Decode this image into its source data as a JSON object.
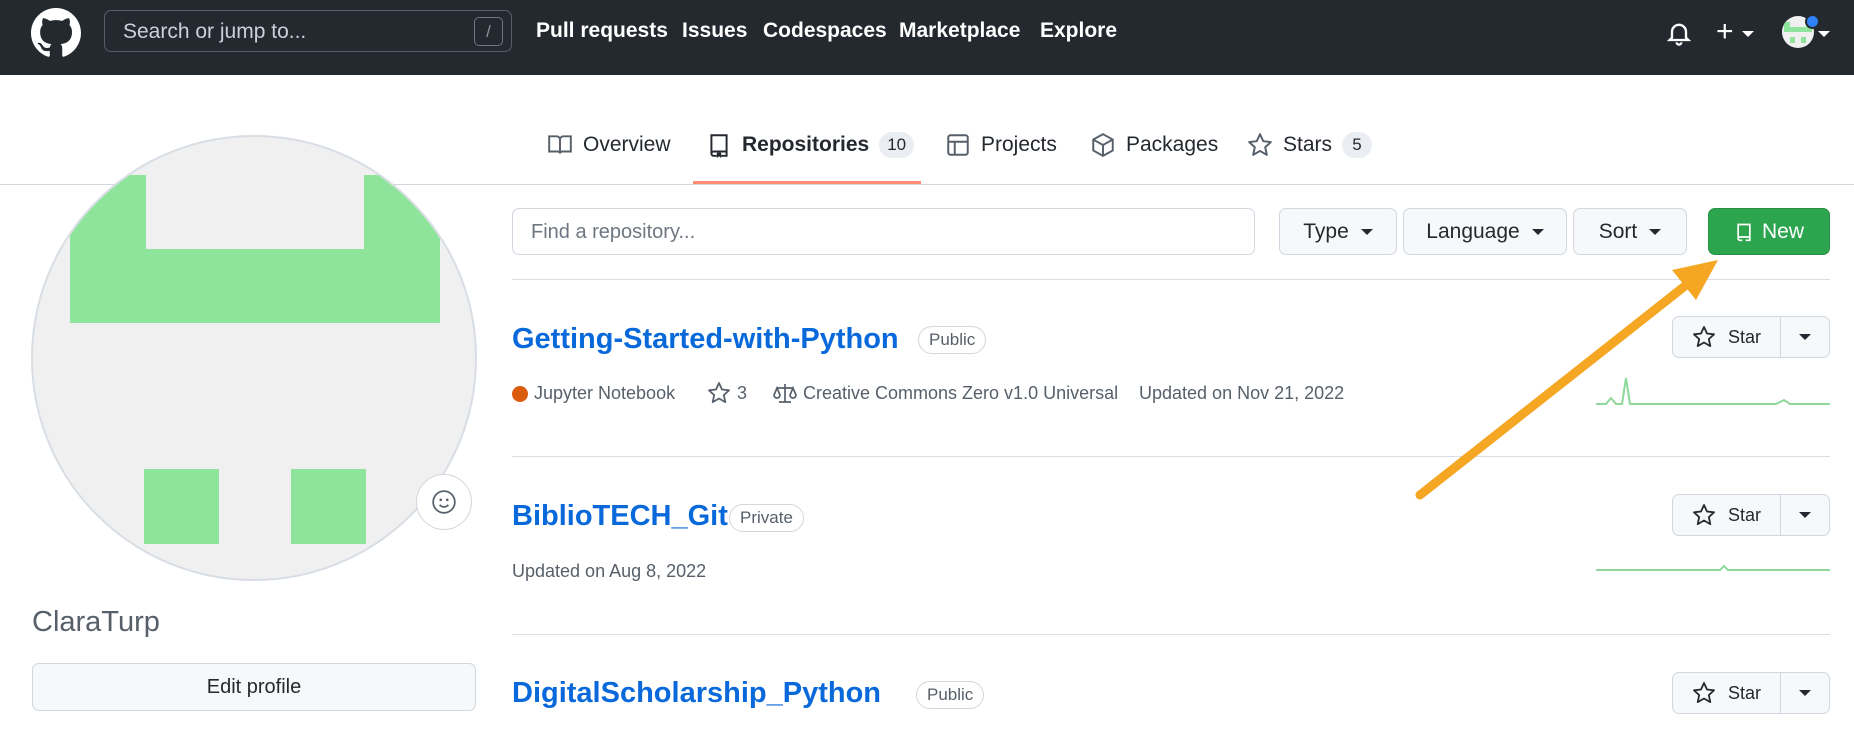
{
  "header": {
    "search_placeholder": "Search or jump to...",
    "search_shortcut": "/",
    "nav": [
      "Pull requests",
      "Issues",
      "Codespaces",
      "Marketplace",
      "Explore"
    ],
    "plus_icon": "+"
  },
  "tabs": [
    {
      "label": "Overview",
      "icon": "book-icon"
    },
    {
      "label": "Repositories",
      "icon": "repo-icon",
      "count": "10",
      "active": true
    },
    {
      "label": "Projects",
      "icon": "table-icon"
    },
    {
      "label": "Packages",
      "icon": "package-icon"
    },
    {
      "label": "Stars",
      "icon": "star-icon",
      "count": "5"
    }
  ],
  "profile": {
    "username": "ClaraTurp",
    "edit_label": "Edit profile"
  },
  "filters": {
    "find_placeholder": "Find a repository...",
    "type_label": "Type",
    "language_label": "Language",
    "sort_label": "Sort",
    "new_label": "New"
  },
  "repos": [
    {
      "name": "Getting-Started-with-Python",
      "visibility": "Public",
      "language": "Jupyter Notebook",
      "language_color": "#da5b0b",
      "stars": "3",
      "license": "Creative Commons Zero v1.0 Universal",
      "updated": "Updated on Nov 21, 2022",
      "star_label": "Star"
    },
    {
      "name": "BiblioTECH_Git",
      "visibility": "Private",
      "updated": "Updated on Aug 8, 2022",
      "star_label": "Star"
    },
    {
      "name": "DigitalScholarship_Python",
      "visibility": "Public",
      "star_label": "Star"
    }
  ],
  "colors": {
    "header_bg": "#24292f",
    "link": "#0969da",
    "new_button": "#2da44e",
    "active_tab_underline": "#fd8c73",
    "annotation_arrow": "#f5a623"
  }
}
